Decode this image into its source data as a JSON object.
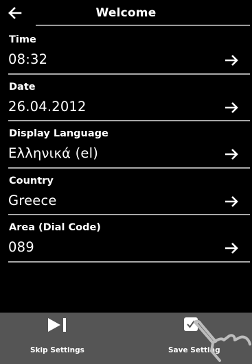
{
  "header": {
    "title": "Welcome",
    "back_icon": "arrow-left-icon"
  },
  "settings": [
    {
      "label": "Time",
      "value": "08:32"
    },
    {
      "label": "Date",
      "value": "26.04.2012"
    },
    {
      "label": "Display Language",
      "value": "Ελληνικά (el)"
    },
    {
      "label": "Country",
      "value": "Greece"
    },
    {
      "label": "Area (Dial Code)",
      "value": "089"
    }
  ],
  "row_icon": "arrow-right-icon",
  "footer": {
    "skip_label": "Skip Settings",
    "skip_icon": "skip-next-icon",
    "save_label": "Save Setting",
    "save_icon": "checkbox-checked-icon"
  },
  "colors": {
    "background": "#000000",
    "text": "#ffffff",
    "divider": "#a8a8a8",
    "footer_background": "#555555"
  }
}
